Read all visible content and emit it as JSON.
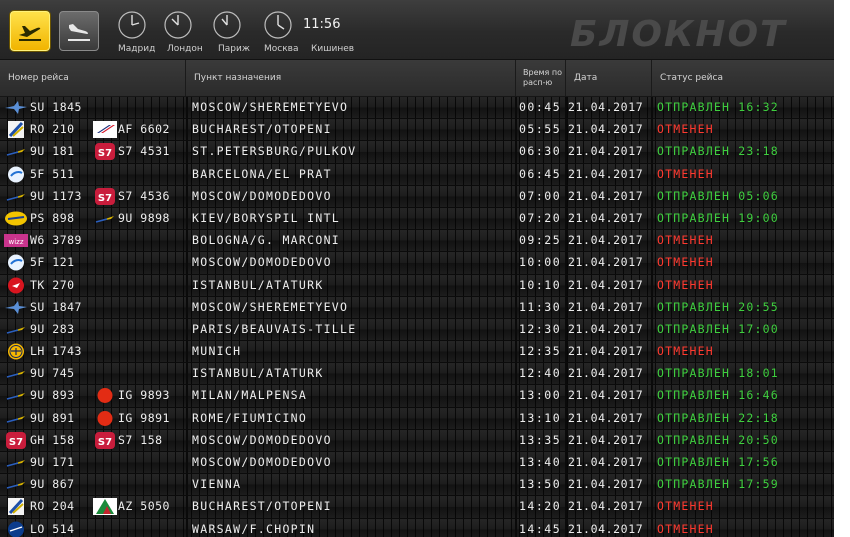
{
  "header": {
    "time": "11:56",
    "brand": "БЛОКНОТ",
    "cities": [
      "Мадрид",
      "Лондон",
      "Париж",
      "Москва",
      "Кишинев"
    ],
    "departures_icon": "plane-takeoff-icon",
    "arrivals_icon": "plane-landing-icon"
  },
  "columns": {
    "flight": "Номер рейса",
    "destination": "Пункт назначения",
    "time": "Время по расп-ю",
    "date": "Дата",
    "status": "Статус рейса"
  },
  "colors": {
    "departed": "#3fcf3f",
    "cancelled": "#ff3a30",
    "button_active": "#f1b400"
  },
  "flights": [
    {
      "logo": "aeroflot",
      "code": "SU 1845",
      "logo2": "",
      "code2": "",
      "destination": "MOSCOW/SHEREMETYEVO",
      "time": "00:45",
      "date": "21.04.2017",
      "status": "ОТПРАВЛЕН 16:32",
      "state": "departed"
    },
    {
      "logo": "air-moldova",
      "code": "RO 210",
      "logo2": "air-france",
      "code2": "AF 6602",
      "destination": "BUCHAREST/OTOPENI",
      "time": "05:55",
      "date": "21.04.2017",
      "status": "ОТМЕНЕН",
      "state": "cancelled"
    },
    {
      "logo": "air-moldova-9u",
      "code": "9U 181",
      "logo2": "s7",
      "code2": "S7 4531",
      "destination": "ST.PETERSBURG/PULKOV",
      "time": "06:30",
      "date": "21.04.2017",
      "status": "ОТПРАВЛЕН 23:18",
      "state": "departed"
    },
    {
      "logo": "fly-one",
      "code": "5F 511",
      "logo2": "",
      "code2": "",
      "destination": "BARCELONA/EL PRAT",
      "time": "06:45",
      "date": "21.04.2017",
      "status": "ОТМЕНЕН",
      "state": "cancelled"
    },
    {
      "logo": "air-moldova-9u",
      "code": "9U 1173",
      "logo2": "s7",
      "code2": "S7 4536",
      "destination": "MOSCOW/DOMODEDOVO",
      "time": "07:00",
      "date": "21.04.2017",
      "status": "ОТПРАВЛЕН 05:06",
      "state": "departed"
    },
    {
      "logo": "ukraine-intl",
      "code": "PS 898",
      "logo2": "air-moldova-9u",
      "code2": "9U 9898",
      "destination": "KIEV/BORYSPIL INTL",
      "time": "07:20",
      "date": "21.04.2017",
      "status": "ОТПРАВЛЕН 19:00",
      "state": "departed"
    },
    {
      "logo": "wizz",
      "code": "W6 3789",
      "logo2": "",
      "code2": "",
      "destination": "BOLOGNA/G. MARCONI",
      "time": "09:25",
      "date": "21.04.2017",
      "status": "ОТМЕНЕН",
      "state": "cancelled"
    },
    {
      "logo": "fly-one",
      "code": "5F 121",
      "logo2": "",
      "code2": "",
      "destination": "MOSCOW/DOMODEDOVO",
      "time": "10:00",
      "date": "21.04.2017",
      "status": "ОТМЕНЕН",
      "state": "cancelled"
    },
    {
      "logo": "turkish",
      "code": "TK 270",
      "logo2": "",
      "code2": "",
      "destination": "ISTANBUL/ATATURK",
      "time": "10:10",
      "date": "21.04.2017",
      "status": "ОТМЕНЕН",
      "state": "cancelled"
    },
    {
      "logo": "aeroflot",
      "code": "SU 1847",
      "logo2": "",
      "code2": "",
      "destination": "MOSCOW/SHEREMETYEVO",
      "time": "11:30",
      "date": "21.04.2017",
      "status": "ОТПРАВЛЕН 20:55",
      "state": "departed"
    },
    {
      "logo": "air-moldova-9u",
      "code": "9U 283",
      "logo2": "",
      "code2": "",
      "destination": "PARIS/BEAUVAIS-TILLE",
      "time": "12:30",
      "date": "21.04.2017",
      "status": "ОТПРАВЛЕН 17:00",
      "state": "departed"
    },
    {
      "logo": "lufthansa",
      "code": "LH 1743",
      "logo2": "",
      "code2": "",
      "destination": "MUNICH",
      "time": "12:35",
      "date": "21.04.2017",
      "status": "ОТМЕНЕН",
      "state": "cancelled"
    },
    {
      "logo": "air-moldova-9u",
      "code": "9U 745",
      "logo2": "",
      "code2": "",
      "destination": "ISTANBUL/ATATURK",
      "time": "12:40",
      "date": "21.04.2017",
      "status": "ОТПРАВЛЕН 18:01",
      "state": "departed"
    },
    {
      "logo": "air-moldova-9u",
      "code": "9U 893",
      "logo2": "meridiana",
      "code2": "IG 9893",
      "destination": "MILAN/MALPENSA",
      "time": "13:00",
      "date": "21.04.2017",
      "status": "ОТПРАВЛЕН 16:46",
      "state": "departed"
    },
    {
      "logo": "air-moldova-9u",
      "code": "9U 891",
      "logo2": "meridiana",
      "code2": "IG 9891",
      "destination": "ROME/FIUMICINO",
      "time": "13:10",
      "date": "21.04.2017",
      "status": "ОТПРАВЛЕН 22:18",
      "state": "departed"
    },
    {
      "logo": "s7",
      "code": "GH 158",
      "logo2": "s7",
      "code2": "S7 158",
      "destination": "MOSCOW/DOMODEDOVO",
      "time": "13:35",
      "date": "21.04.2017",
      "status": "ОТПРАВЛЕН 20:50",
      "state": "departed"
    },
    {
      "logo": "air-moldova-9u",
      "code": "9U 171",
      "logo2": "",
      "code2": "",
      "destination": "MOSCOW/DOMODEDOVO",
      "time": "13:40",
      "date": "21.04.2017",
      "status": "ОТПРАВЛЕН 17:56",
      "state": "departed"
    },
    {
      "logo": "air-moldova-9u",
      "code": "9U 867",
      "logo2": "",
      "code2": "",
      "destination": "VIENNA",
      "time": "13:50",
      "date": "21.04.2017",
      "status": "ОТПРАВЛЕН 17:59",
      "state": "departed"
    },
    {
      "logo": "air-moldova",
      "code": "RO 204",
      "logo2": "alitalia",
      "code2": "AZ 5050",
      "destination": "BUCHAREST/OTOPENI",
      "time": "14:20",
      "date": "21.04.2017",
      "status": "ОТМЕНЕН",
      "state": "cancelled"
    },
    {
      "logo": "lot",
      "code": "LO 514",
      "logo2": "",
      "code2": "",
      "destination": "WARSAW/F.CHOPIN",
      "time": "14:45",
      "date": "21.04.2017",
      "status": "ОТМЕНЕН",
      "state": "cancelled"
    }
  ]
}
